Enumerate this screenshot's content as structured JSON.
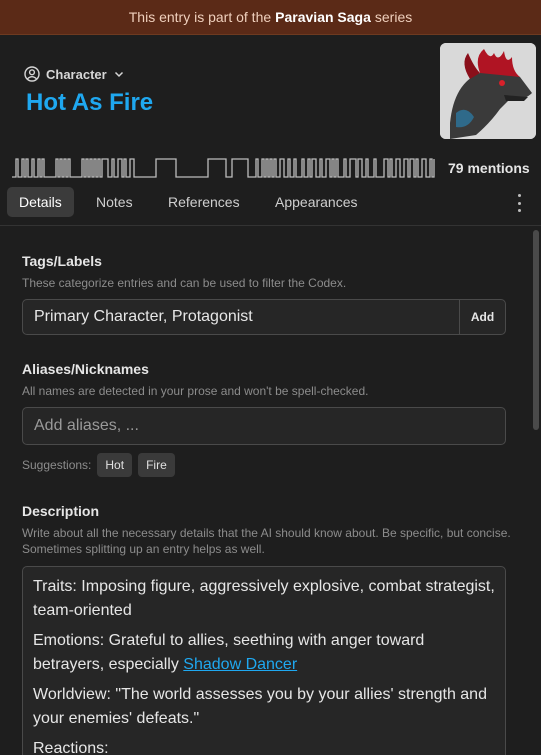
{
  "banner": {
    "prefix": "This entry is part of the",
    "series_name": "Paravian Saga",
    "suffix": "series"
  },
  "header": {
    "entry_type": "Character",
    "title": "Hot As Fire"
  },
  "mentions": {
    "count_label": "79 mentions"
  },
  "tabs": [
    {
      "label": "Details",
      "active": true
    },
    {
      "label": "Notes"
    },
    {
      "label": "References"
    },
    {
      "label": "Appearances"
    }
  ],
  "tags": {
    "title": "Tags/Labels",
    "hint": "These categorize entries and can be used to filter the Codex.",
    "value": "Primary Character, Protagonist",
    "add_label": "Add"
  },
  "aliases": {
    "title": "Aliases/Nicknames",
    "hint": "All names are detected in your prose and won't be spell-checked.",
    "placeholder": "Add aliases, ...",
    "suggestions_label": "Suggestions:",
    "suggestions": [
      "Hot",
      "Fire"
    ]
  },
  "description": {
    "title": "Description",
    "hint": "Write about all the necessary details that the AI should know about. Be specific, but concise. Sometimes splitting up an entry helps as well.",
    "traits": "Traits: Imposing figure, aggressively explosive, combat strategist, team-oriented",
    "emotions_prefix": "Emotions: Grateful to allies, seething with anger toward betrayers, especially",
    "emotions_link": "Shadow Dancer",
    "worldview": "Worldview: \"The world assesses you by your allies' strength and your enemies' defeats.\"",
    "reactions": "Reactions:"
  },
  "colors": {
    "accent": "#1fa8f0",
    "banner_bg": "#5b2a17",
    "bg": "#1e1e1e"
  }
}
